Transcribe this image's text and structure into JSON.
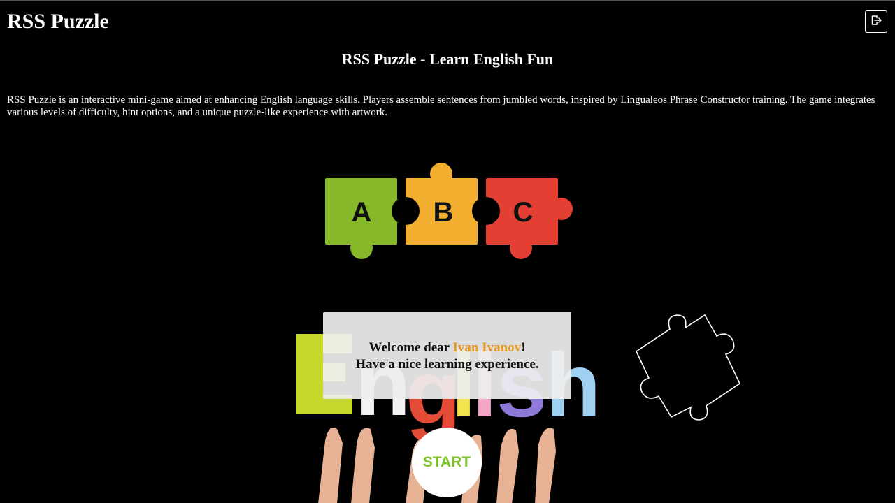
{
  "header": {
    "app_title": "RSS Puzzle",
    "logout_icon": "logout-icon"
  },
  "main": {
    "subtitle": "RSS Puzzle - Learn English Fun",
    "description": "RSS Puzzle is an interactive mini-game aimed at enhancing English language skills. Players assemble sentences from jumbled words, inspired by Lingualeos Phrase Constructor training. The game integrates various levels of difficulty, hint options, and a unique puzzle-like experience with artwork.",
    "puzzle_letters": [
      "A",
      "B",
      "C"
    ],
    "art_word": "English"
  },
  "welcome": {
    "greeting": "Welcome dear ",
    "user_name": "Ivan Ivanov",
    "exclamation": "!",
    "message": "Have a nice learning experience."
  },
  "start_button": {
    "label": "START"
  },
  "colors": {
    "background": "#000000",
    "accent_name": "#e8961c",
    "start_text": "#7cc421",
    "piece_green": "#86b82a",
    "piece_orange": "#f2ae2e",
    "piece_red": "#e33f33"
  }
}
